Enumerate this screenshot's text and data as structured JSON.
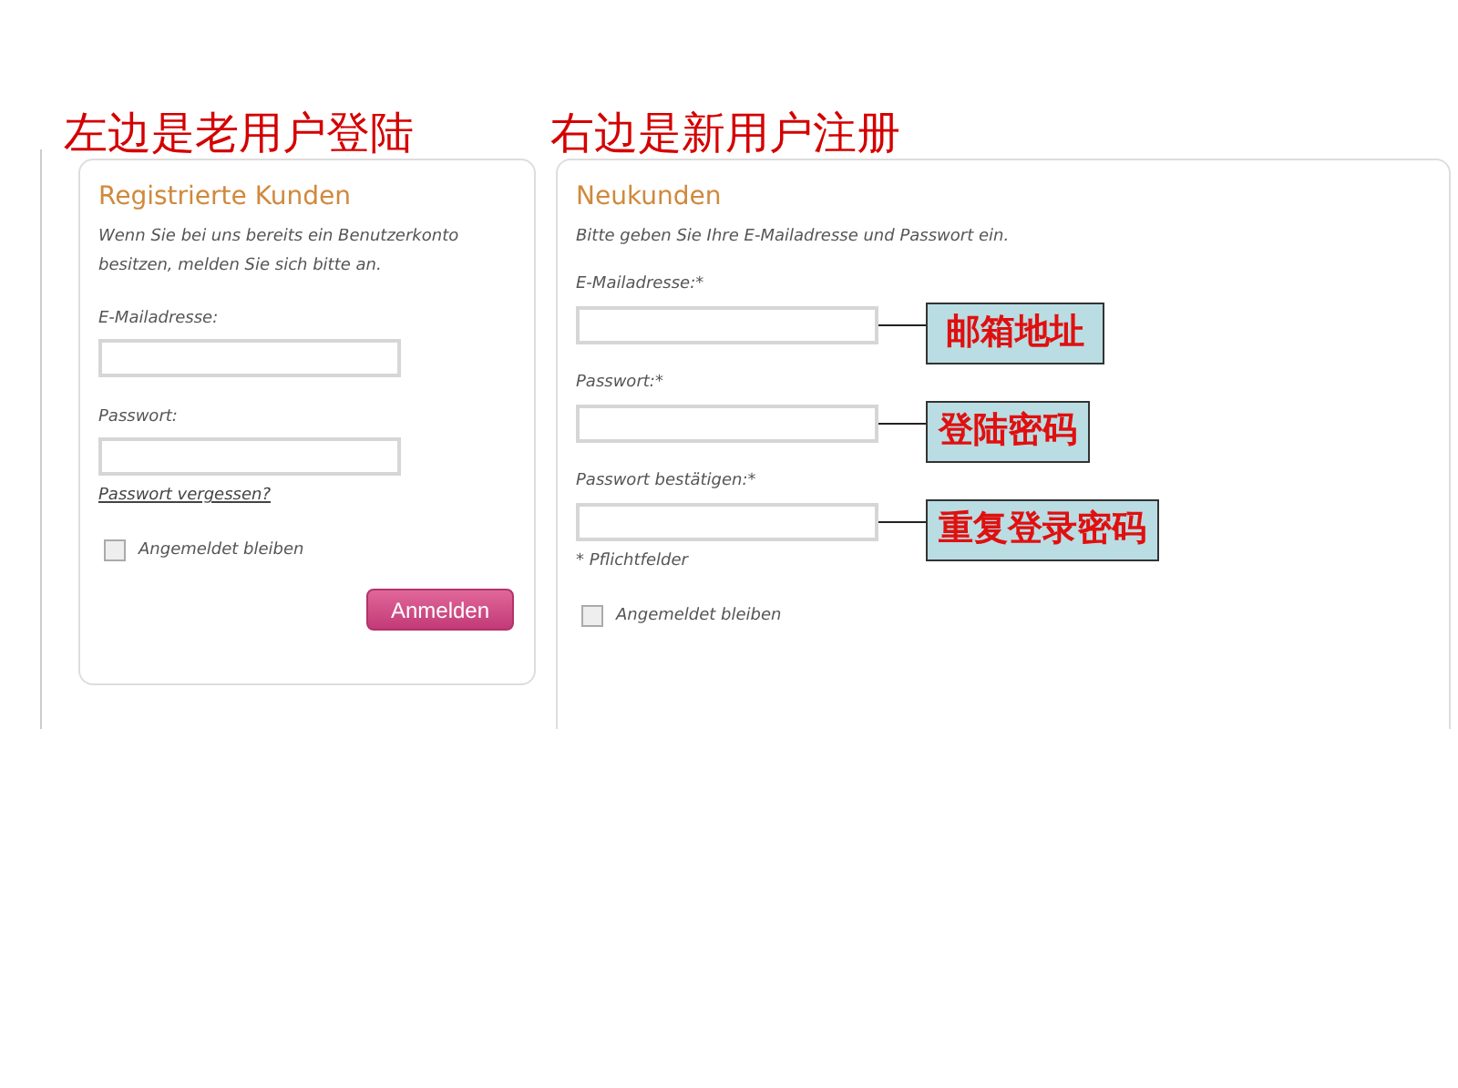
{
  "annotations": {
    "left": "左边是老用户登陆",
    "right": "右边是新用户注册"
  },
  "login": {
    "title": "Registrierte Kunden",
    "intro": "Wenn Sie bei uns bereits ein Benutzerkonto besitzen, melden Sie sich bitte an.",
    "fields": [
      {
        "label": "E-Mailadresse:"
      },
      {
        "label": "Passwort:"
      }
    ],
    "forgot_link": "Passwort vergessen?",
    "remember": {
      "label": "Angemeldet bleiben",
      "checked": false
    },
    "button": "Anmelden"
  },
  "register": {
    "title": "Neukunden",
    "intro": "Bitte geben Sie Ihre E-Mailadresse und Passwort ein.",
    "fields": [
      {
        "label": "E-Mailadresse:*",
        "note": "邮箱地址"
      },
      {
        "label": "Passwort:*",
        "note": "登陆密码"
      },
      {
        "label": "Passwort bestätigen:*",
        "note": "重复登录密码"
      }
    ],
    "required_note": "* Pflichtfelder",
    "remember": {
      "label": "Angemeldet bleiben",
      "checked": false
    }
  }
}
